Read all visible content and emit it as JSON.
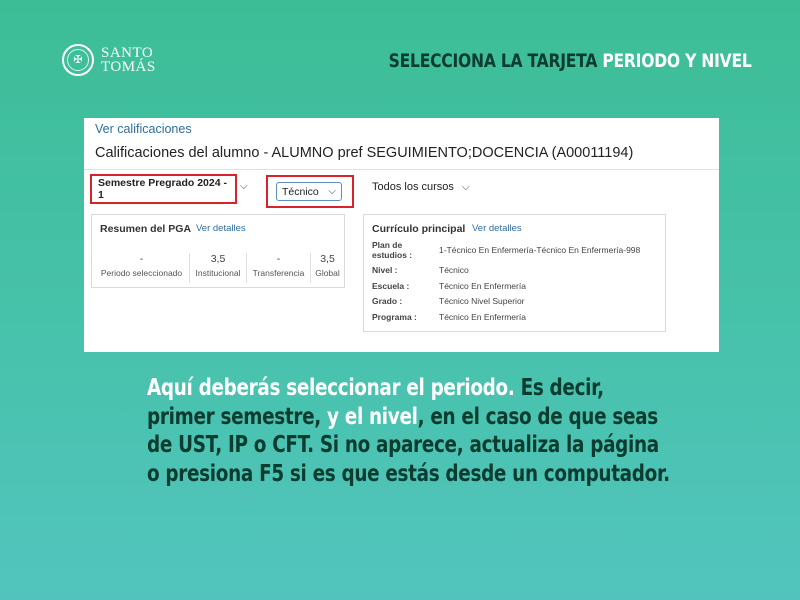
{
  "logo": {
    "line1": "SANTO",
    "line2": "TOMÁS",
    "icon": "seal-icon"
  },
  "headline": {
    "part_dark": "SELECCIONA LA TARJETA",
    "part_light": "PERIODO Y NIVEL"
  },
  "screen": {
    "breadcrumb": "Ver calificaciones",
    "title": "Calificaciones del alumno - ALUMNO pref SEGUIMIENTO;DOCENCIA (A00011194)",
    "period_select": "Semestre Pregrado 2024 - 1",
    "level_select": "Técnico",
    "courses_select": "Todos los cursos",
    "pga": {
      "title": "Resumen del PGA",
      "link": "Ver detalles",
      "stats": [
        {
          "value": "-",
          "label": "Periodo seleccionado"
        },
        {
          "value": "3,5",
          "label": "Institucional"
        },
        {
          "value": "-",
          "label": "Transferencia"
        },
        {
          "value": "3,5",
          "label": "Global"
        }
      ]
    },
    "curriculum": {
      "title": "Currículo principal",
      "link": "Ver detalles",
      "rows": [
        {
          "key": "Plan de estudios :",
          "value": "1-Técnico En Enfermería-Técnico En Enfermería-998"
        },
        {
          "key": "Nivel :",
          "value": "Técnico"
        },
        {
          "key": "Escuela :",
          "value": "Técnico En Enfermería"
        },
        {
          "key": "Grado :",
          "value": "Técnico Nivel Superior"
        },
        {
          "key": "Programa :",
          "value": "Técnico En Enfermería"
        }
      ]
    }
  },
  "instructions": {
    "p1_light": "Aquí deberás seleccionar el periodo.",
    "p2_dark": " Es decir, primer semestre,",
    "p3_light": " y el nivel",
    "p4_dark": ", en el caso de que seas de UST, IP o CFT. Si no aparece, actualiza la página o presiona F5 si es que estás desde un computador."
  },
  "colors": {
    "background": "#45c0a8",
    "dark_text": "#0c3b2f",
    "highlight_border": "#d8232a",
    "link": "#2d6e9e"
  }
}
